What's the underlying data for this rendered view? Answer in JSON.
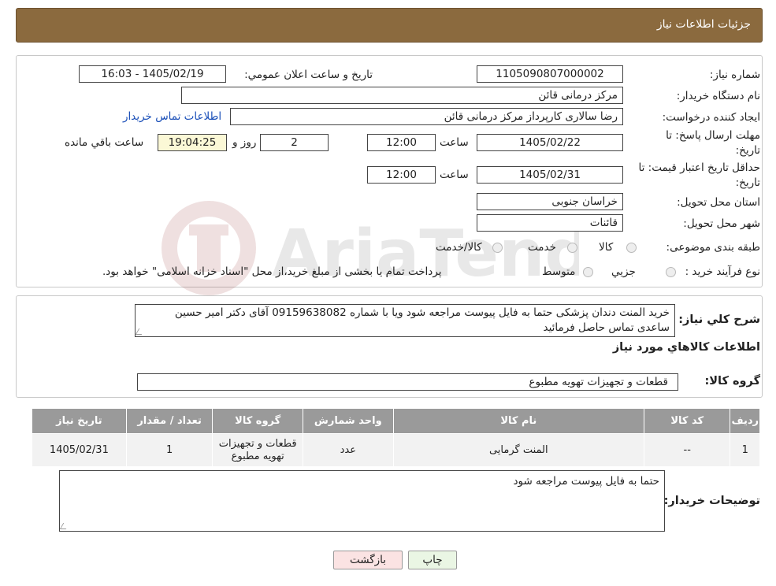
{
  "header": {
    "title": "جزئیات اطلاعات نیاز"
  },
  "form": {
    "need_number_label": "شماره نیاز:",
    "need_number": "1105090807000002",
    "announce_label": "تاریخ و ساعت اعلان عمومي:",
    "announce_value": "1405/02/19 - 16:03",
    "buyer_org_label": "نام دستگاه خريدار:",
    "buyer_org": "مرکز درمانی قائن",
    "creator_label": "ايجاد کننده درخواست:",
    "creator": "رضا سالاری کارپرداز مرکز درمانی قائن",
    "contact_link": "اطلاعات تماس خريدار",
    "reply_deadline_label_1": "مهلت ارسال پاسخ: تا",
    "reply_deadline_label_2": "تاریخ:",
    "reply_date": "1405/02/22",
    "time_label": "ساعت",
    "reply_time": "12:00",
    "days_value": "2",
    "days_label": "روز و",
    "remaining_time": "19:04:25",
    "remaining_label": "ساعت باقي مانده",
    "validity_label_1": "حداقل تاريخ اعتبار قيمت: تا",
    "validity_label_2": "تاريخ:",
    "validity_date": "1405/02/31",
    "validity_time": "12:00",
    "province_label": "استان محل تحويل:",
    "province": "خراسان جنوبی",
    "city_label": "شهر محل تحويل:",
    "city": "قائنات",
    "category_label": "طبقه بندی موضوعی:",
    "category_options": [
      "کالا",
      "خدمت",
      "کالا/خدمت"
    ],
    "process_label": "نوع فرآيند خريد :",
    "process_options": [
      "جزيي",
      "متوسط"
    ],
    "process_note": "پرداخت تمام يا بخشی از مبلغ خريد،از محل \"اسناد خزانه اسلامی\" خواهد بود."
  },
  "description": {
    "label": "شرح کلي نياز:",
    "text": "خرید المنت دندان پزشکی حتما به فایل پیوست مراجعه شود ویا با شماره  09159638082  آقای دکتر امیر حسین ساعدی تماس حاصل فرمائید",
    "items_title": "اطلاعات کالاهاي مورد نياز"
  },
  "goods_group": {
    "label": "گروه کالا:",
    "value": "قطعات و تجهيزات تهويه مطبوع"
  },
  "table": {
    "headers": [
      "رديف",
      "کد کالا",
      "نام کالا",
      "واحد شمارش",
      "گروه کالا",
      "تعداد / مقدار",
      "تاريخ نياز"
    ],
    "rows": [
      [
        "1",
        "--",
        "المنت گرمایی",
        "عدد",
        "قطعات و تجهيزات تهويه مطبوع",
        "1",
        "1405/02/31"
      ]
    ]
  },
  "buyer_notes": {
    "label": "توضيحات خريدار:",
    "text": "حتما به فایل پیوست مراجعه شود"
  },
  "buttons": {
    "print": "چاپ",
    "back": "بازگشت"
  },
  "watermark_text": "AriaTender.neT"
}
